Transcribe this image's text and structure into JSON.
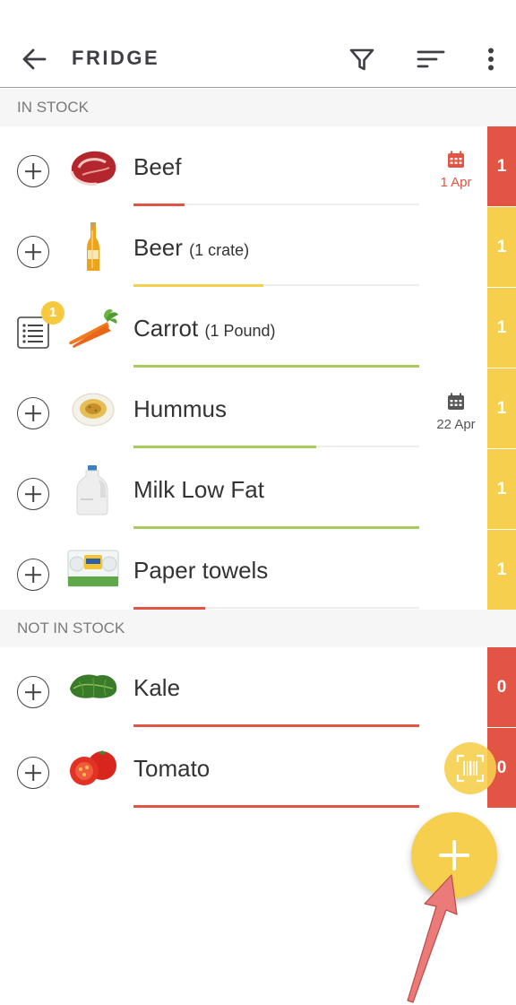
{
  "header": {
    "title": "FRIDGE",
    "back_icon": "arrow-left-icon",
    "filter_icon": "filter-icon",
    "sort_icon": "sort-icon",
    "menu_icon": "more-vert-icon"
  },
  "sections": {
    "in_stock": "IN STOCK",
    "not_in_stock": "NOT IN STOCK"
  },
  "colors": {
    "red": "#e25444",
    "yellow": "#f7cf4e",
    "green": "#a8cc5c"
  },
  "items": [
    {
      "name": "Beef",
      "qty": "",
      "count": "1",
      "date": "1 Apr",
      "date_color": "#e25444",
      "bar_color": "#e25444",
      "bar_fraction": 0.18,
      "badge_color": "#e25444",
      "icon": "beef-image"
    },
    {
      "name": "Beer",
      "qty": "(1 crate)",
      "count": "1",
      "date": "",
      "bar_color": "#f7cf4e",
      "bar_fraction": 0.45,
      "badge_color": "#f7cf4e",
      "icon": "beer-bottle-image"
    },
    {
      "name": "Carrot",
      "qty": "(1 Pound)",
      "count": "1",
      "date": "",
      "bar_color": "#a8cc5c",
      "bar_fraction": 1.0,
      "badge_color": "#f7cf4e",
      "icon": "carrot-image",
      "list_badge": "1"
    },
    {
      "name": "Hummus",
      "qty": "",
      "count": "1",
      "date": "22 Apr",
      "date_color": "#555555",
      "bar_color": "#a8cc5c",
      "bar_fraction": 0.64,
      "badge_color": "#f7cf4e",
      "icon": "hummus-image"
    },
    {
      "name": "Milk Low Fat",
      "qty": "",
      "count": "1",
      "date": "",
      "bar_color": "#a8cc5c",
      "bar_fraction": 1.0,
      "badge_color": "#f7cf4e",
      "icon": "milk-jug-image"
    },
    {
      "name": "Paper towels",
      "qty": "",
      "count": "1",
      "date": "",
      "bar_color": "#e25444",
      "bar_fraction": 0.25,
      "badge_color": "#f7cf4e",
      "icon": "paper-towels-image"
    }
  ],
  "not_in_stock_items": [
    {
      "name": "Kale",
      "qty": "",
      "count": "0",
      "bar_color": "#e25444",
      "bar_fraction": 1.0,
      "badge_color": "#e25444",
      "icon": "kale-image"
    },
    {
      "name": "Tomato",
      "qty": "",
      "count": "0",
      "bar_color": "#e25444",
      "bar_fraction": 1.0,
      "badge_color": "#e25444",
      "icon": "tomato-image"
    }
  ],
  "fab": {
    "icon": "plus-icon",
    "scan_icon": "barcode-scan-icon"
  }
}
